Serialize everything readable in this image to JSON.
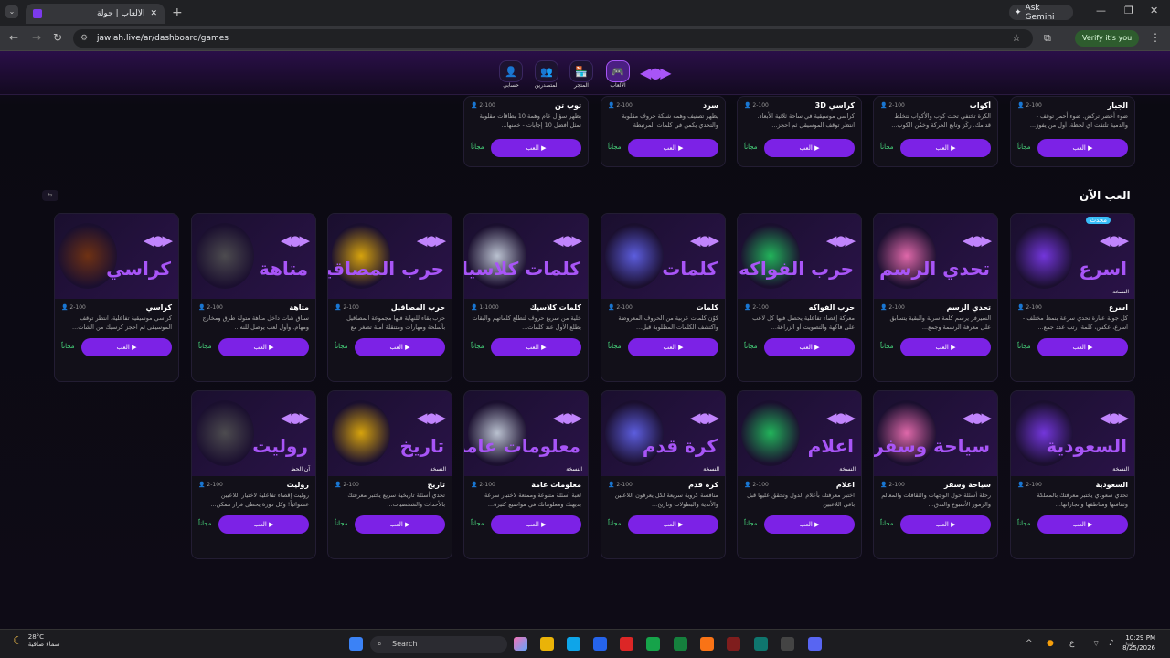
{
  "browser": {
    "tab_title": "الألعاب | جولة",
    "url": "jawlah.live/ar/dashboard/games",
    "gemini": "Ask Gemini",
    "verify": "Verify it's you"
  },
  "nav": {
    "items": [
      "الألعاب",
      "المتجر",
      "المتصدرين",
      "حسابي"
    ]
  },
  "section_title": "العب الآن",
  "play_label": "العب",
  "free_label": "مجاناً",
  "top_row": [
    {
      "name": "الجبار",
      "players": "2-100",
      "desc": "ضوء أخضر تركض. ضوء أحمر توقف - والدمية تلتفت اي لحظة. أول من يفوز..."
    },
    {
      "name": "أكواب",
      "players": "2-100",
      "desc": "الكرة تختفي تحت كوب والأكواب تتخلط قدامك. ركّز وتابع الحركة وخمّن الكوب..."
    },
    {
      "name": "كراسي 3D",
      "players": "2-100",
      "desc": "كراسي موسيقية في ساحة ثلاثية الأبعاد. انتظر توقف الموسيقى ثم احجز..."
    },
    {
      "name": "سرد",
      "players": "2-100",
      "desc": "يظهر تصنيف وهمه شبكة حروف مقلوبة والتحدي يكمن في كلمات المرتبطة المخفي..."
    },
    {
      "name": "توب تن",
      "players": "2-100",
      "desc": "يظهر سؤال عام وهمة 10 بطاقات مقلوبة تمثل أفضل 10 إجابات - خمنها..."
    }
  ],
  "row2": [
    {
      "name": "اسرع",
      "title": "اسرع",
      "players": "2-100",
      "desc": "كل جولة عبارة تحدي سرعة بنمط مختلف - اسرع، عكس، كلمة، رتب عدد جمع...",
      "badge": "محدث",
      "tag": "النسخة"
    },
    {
      "name": "تحدي الرسم",
      "title": "تحدي الرسم",
      "players": "2-100",
      "desc": "السيرفر يرسم كلمة سرية والبقية يتسابق على معرفة الرسمة وجمع...",
      "tag": ""
    },
    {
      "name": "حرب الفواكه",
      "title": "حرب الفواكه",
      "players": "2-100",
      "desc": "معركة إقصاء تفاعلية يحصل فيها كل لاعب على فاكهة والتصويت أو الزراعة...",
      "tag": ""
    },
    {
      "name": "كلمات",
      "title": "كلمات",
      "players": "2-100",
      "desc": "كوّن كلمات عربية من الحروف المعروضة واكتشف الكلمات المطلوبة قبل...",
      "tag": ""
    },
    {
      "name": "كلمات كلاسيك",
      "title": "كلمات كلاسيك",
      "players": "1-1000",
      "desc": "خلية من سريع حروف لتطلع كلماتهم والبقات يطلع الأول عند كلمات...",
      "tag": ""
    },
    {
      "name": "حرب المصاقيل",
      "title": "حرب المصاقيل",
      "players": "2-100",
      "desc": "حرب بقاء للنهاية فيها مجموعة المصاقيل بأسلحة ومهارات ومتنقلة أمنة تصغر مع الوقت...",
      "tag": ""
    },
    {
      "name": "متاهة",
      "title": "متاهة",
      "players": "2-100",
      "desc": "سباق شات داخل متاهة متولة طرق ومخارج ومهام. وأول لعب يوصل للنه...",
      "tag": ""
    },
    {
      "name": "كراسي",
      "title": "كراسي",
      "players": "2-100",
      "desc": "كراسي موسيقية تفاعلية. انتظر توقف الموسيقى ثم احجز كرسيك من الشات...",
      "tag": ""
    }
  ],
  "row3": [
    {
      "name": "السعودية",
      "title": "السعودية",
      "players": "2-100",
      "desc": "تحدي سعودي يختبر معرفتك بالمملكة وثقافتها ومناطقها وإنجازاتها...",
      "tag": "النسخة"
    },
    {
      "name": "سياحة وسفر",
      "title": "سياحة وسفر",
      "players": "2-100",
      "desc": "رحلة أسئلة حول الوجهات والثقافات والمعالم والرموز الأسبوع والتدق...",
      "tag": ""
    },
    {
      "name": "اعلام",
      "title": "اعلام",
      "players": "2-100",
      "desc": "اختبر معرفتك بأعلام الدول وتحقق عليها قبل باقي اللاعبين",
      "tag": "النسخة"
    },
    {
      "name": "كرة قدم",
      "title": "كرة قدم",
      "players": "2-100",
      "desc": "منافسة كروية سريعة لكل يعرفون اللاعبين والأندية والبطولات وتاريخ...",
      "tag": "النسخة"
    },
    {
      "name": "معلومات عامة",
      "title": "معلومات عامة",
      "players": "2-100",
      "desc": "لعبة أسئلة متنوعة وممتعة لاختبار سرعة بديهتك ومعلوماتك في مواضيع كثيرة...",
      "tag": "النسخة"
    },
    {
      "name": "تاريخ",
      "title": "تاريخ",
      "players": "2-100",
      "desc": "تحدي أسئلة تاريخية سريع يختبر معرفتك بالأحداث والشخصيات...",
      "tag": "النسخة"
    },
    {
      "name": "روليت",
      "title": "روليت",
      "players": "2-100",
      "desc": "روليت إقصاء تفاعلية لاختيار اللاعبين عشوائياً! وكل دورة يحظى فرار ممكن...",
      "tag": "آن الحظ"
    }
  ],
  "taskbar": {
    "temp": "28°C",
    "weather": "سماء صافية",
    "search": "Search",
    "time": "10:29 PM",
    "date": "8/25/2026"
  }
}
